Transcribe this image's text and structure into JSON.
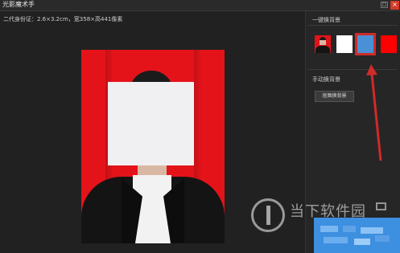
{
  "window": {
    "title": "光影魔术手",
    "maximize_symbol": "□",
    "close_symbol": "×"
  },
  "photo": {
    "info": "二代身份证：2.6×3.2cm，宽358×高441像素",
    "background_color": "#e4131a"
  },
  "right_panel": {
    "one_click_label": "一键换背景",
    "swatches": [
      {
        "name": "original",
        "color": "#e4131a"
      },
      {
        "name": "white",
        "color": "#ffffff"
      },
      {
        "name": "blue",
        "color": "#4a90d6",
        "selected": true
      },
      {
        "name": "red",
        "color": "#ff0000"
      }
    ],
    "manual_label": "手动换背景",
    "manual_button": "抠图换背景"
  },
  "watermark": {
    "text": "当下软件园"
  },
  "colors": {
    "highlight": "#d02a2a",
    "accent_blue": "#4a90d6"
  }
}
